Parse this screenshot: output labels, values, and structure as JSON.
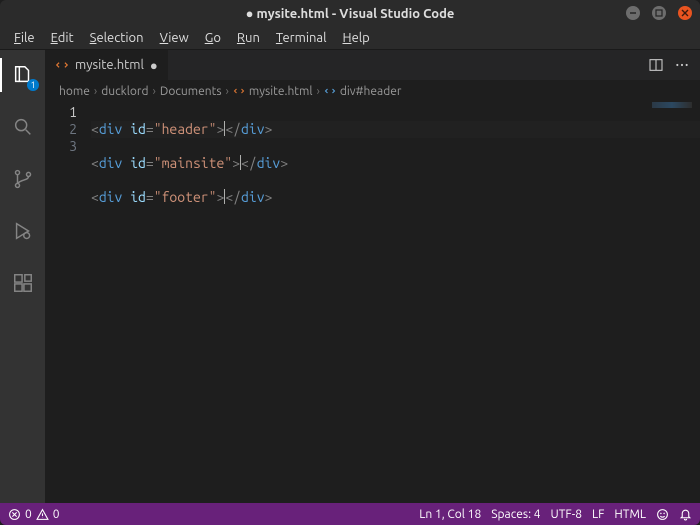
{
  "titlebar": {
    "dirty_dot": "●",
    "title": "mysite.html - Visual Studio Code"
  },
  "menubar": {
    "file": "File",
    "edit": "Edit",
    "selection": "Selection",
    "view": "View",
    "go": "Go",
    "run": "Run",
    "terminal": "Terminal",
    "help": "Help"
  },
  "activity": {
    "explorer_badge": "1"
  },
  "tab": {
    "label": "mysite.html",
    "dirty": "●"
  },
  "breadcrumbs": {
    "items": [
      "home",
      "ducklord",
      "Documents",
      "mysite.html",
      "div#header"
    ],
    "sep": "›"
  },
  "editor": {
    "lines": [
      {
        "n": "1",
        "tag": "div",
        "attr": "id",
        "val": "\"header\"",
        "current": true
      },
      {
        "n": "2",
        "tag": "div",
        "attr": "id",
        "val": "\"mainsite\"",
        "current": false
      },
      {
        "n": "3",
        "tag": "div",
        "attr": "id",
        "val": "\"footer\"",
        "current": false
      }
    ]
  },
  "status": {
    "errors": "0",
    "warnings": "0",
    "ln_col": "Ln 1, Col 18",
    "spaces": "Spaces: 4",
    "encoding": "UTF-8",
    "eol": "LF",
    "lang": "HTML"
  }
}
